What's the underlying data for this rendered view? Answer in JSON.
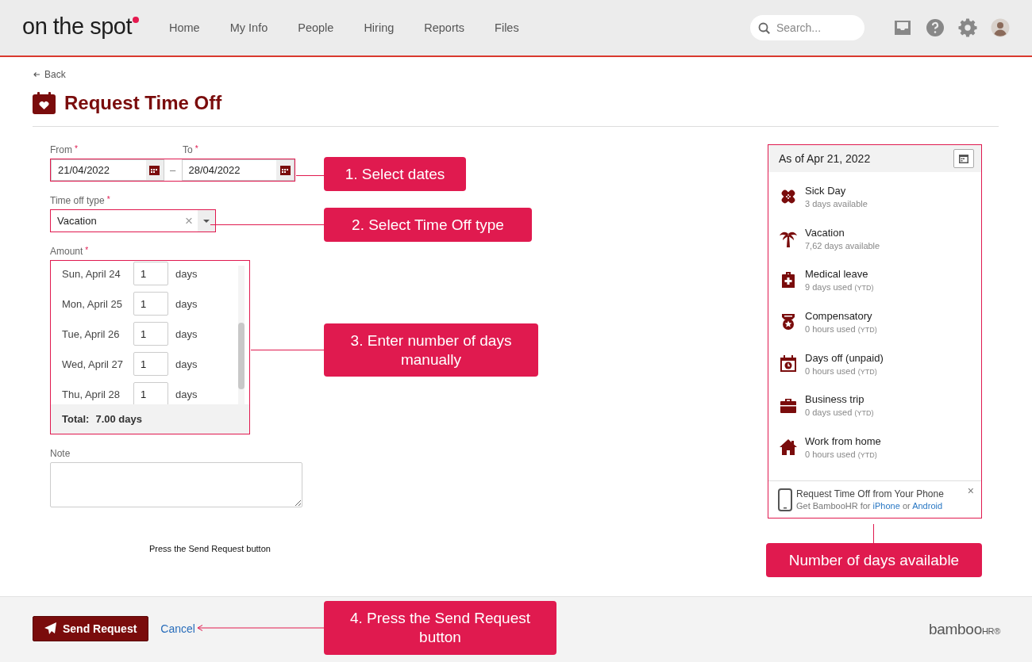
{
  "header": {
    "logo": "on the spot",
    "nav": [
      {
        "label": "Home"
      },
      {
        "label": "My Info"
      },
      {
        "label": "People"
      },
      {
        "label": "Hiring"
      },
      {
        "label": "Reports"
      },
      {
        "label": "Files"
      }
    ],
    "search": {
      "placeholder": "Search..."
    }
  },
  "back": "Back",
  "page_title": "Request Time Off",
  "form": {
    "from": {
      "label": "From",
      "required_mark": "*",
      "value": "21/04/2022"
    },
    "range_separator": "–",
    "to": {
      "label": "To",
      "required_mark": "*",
      "value": "28/04/2022"
    },
    "time_off_type": {
      "label": "Time off type",
      "required_mark": "*",
      "value": "Vacation",
      "clear": "×"
    },
    "amount": {
      "label": "Amount",
      "required_mark": "*",
      "rows": [
        {
          "date": "Sun, April 24",
          "value": "1",
          "unit": "days"
        },
        {
          "date": "Mon, April 25",
          "value": "1",
          "unit": "days"
        },
        {
          "date": "Tue, April 26",
          "value": "1",
          "unit": "days"
        },
        {
          "date": "Wed, April 27",
          "value": "1",
          "unit": "days"
        },
        {
          "date": "Thu, April 28",
          "value": "1",
          "unit": "days"
        }
      ],
      "total_label": "Total:",
      "total_value": "7.00 days"
    },
    "note": {
      "label": "Note"
    },
    "hint": "Press the Send Request button"
  },
  "balance": {
    "as_of": "As of Apr 21, 2022",
    "items": [
      {
        "kind": "sick",
        "name": "Sick Day",
        "detail": "3 days available"
      },
      {
        "kind": "vacation",
        "name": "Vacation",
        "detail": "7,62 days available"
      },
      {
        "kind": "medical",
        "name": "Medical leave",
        "detail": "9 days used",
        "note": "(YTD)"
      },
      {
        "kind": "compensatory",
        "name": "Compensatory",
        "detail": "0 hours used",
        "note": "(YTD)"
      },
      {
        "kind": "unpaid",
        "name": "Days off (unpaid)",
        "detail": "0 hours used",
        "note": "(YTD)"
      },
      {
        "kind": "business",
        "name": "Business trip",
        "detail": "0 days used",
        "note": "(YTD)"
      },
      {
        "kind": "home",
        "name": "Work from home",
        "detail": "0 hours used",
        "note": "(YTD)"
      }
    ],
    "promo": {
      "title": "Request Time Off from Your Phone",
      "lead": "Get BambooHR for",
      "links": [
        "iPhone",
        "Android"
      ],
      "joiner": "or",
      "close": "×"
    }
  },
  "footer": {
    "send": "Send Request",
    "cancel": "Cancel",
    "brand": "bamboo",
    "brand_suffix": "HR®"
  },
  "annotations": [
    {
      "text": "1. Select dates"
    },
    {
      "text": "2. Select Time Off type"
    },
    {
      "text": "3. Enter number of days manually"
    },
    {
      "text": "Number of days available"
    },
    {
      "text": "4. Press the Send Request button"
    }
  ]
}
